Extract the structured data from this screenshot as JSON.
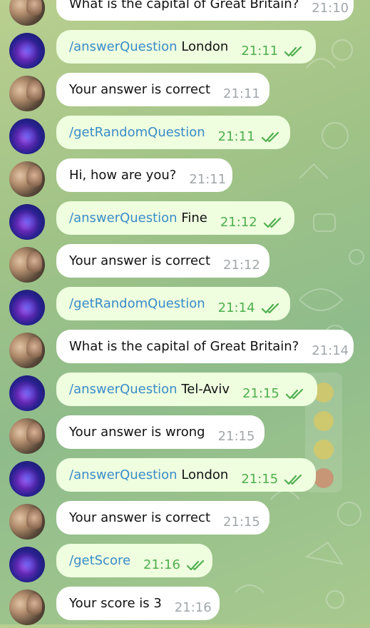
{
  "messages": [
    {
      "sender": "user",
      "text": "What is the capital of Great Britain?",
      "time": "21:10"
    },
    {
      "sender": "bot",
      "command": "/answerQuestion",
      "text": "London",
      "time": "21:11",
      "read": true
    },
    {
      "sender": "user",
      "text": "Your answer is correct",
      "time": "21:11"
    },
    {
      "sender": "bot",
      "command": "/getRandomQuestion",
      "text": "",
      "time": "21:11",
      "read": true
    },
    {
      "sender": "user",
      "text": "Hi, how are you?",
      "time": "21:11"
    },
    {
      "sender": "bot",
      "command": "/answerQuestion",
      "text": "Fine",
      "time": "21:12",
      "read": true
    },
    {
      "sender": "user",
      "text": "Your answer is correct",
      "time": "21:12"
    },
    {
      "sender": "bot",
      "command": "/getRandomQuestion",
      "text": "",
      "time": "21:14",
      "read": true
    },
    {
      "sender": "user",
      "text": "What is the capital of Great Britain?",
      "time": "21:14"
    },
    {
      "sender": "bot",
      "command": "/answerQuestion",
      "text": "Tel-Aviv",
      "time": "21:15",
      "read": true
    },
    {
      "sender": "user",
      "text": "Your answer is wrong",
      "time": "21:15"
    },
    {
      "sender": "bot",
      "command": "/answerQuestion",
      "text": "London",
      "time": "21:15",
      "read": true
    },
    {
      "sender": "user",
      "text": "Your answer is correct",
      "time": "21:15"
    },
    {
      "sender": "bot",
      "command": "/getScore",
      "text": "",
      "time": "21:16",
      "read": true
    },
    {
      "sender": "user",
      "text": "Your score is 3",
      "time": "21:16"
    }
  ],
  "icons": {
    "read_receipt": "double-check-icon",
    "bot_avatar": "bot-avatar",
    "user_avatar": "user-avatar"
  },
  "colors": {
    "command_link": "#3a8bc8",
    "outgoing_bubble": "#eefedf",
    "incoming_bubble": "#ffffff",
    "read_time": "#4fae4e",
    "time": "#a2a7ab"
  }
}
